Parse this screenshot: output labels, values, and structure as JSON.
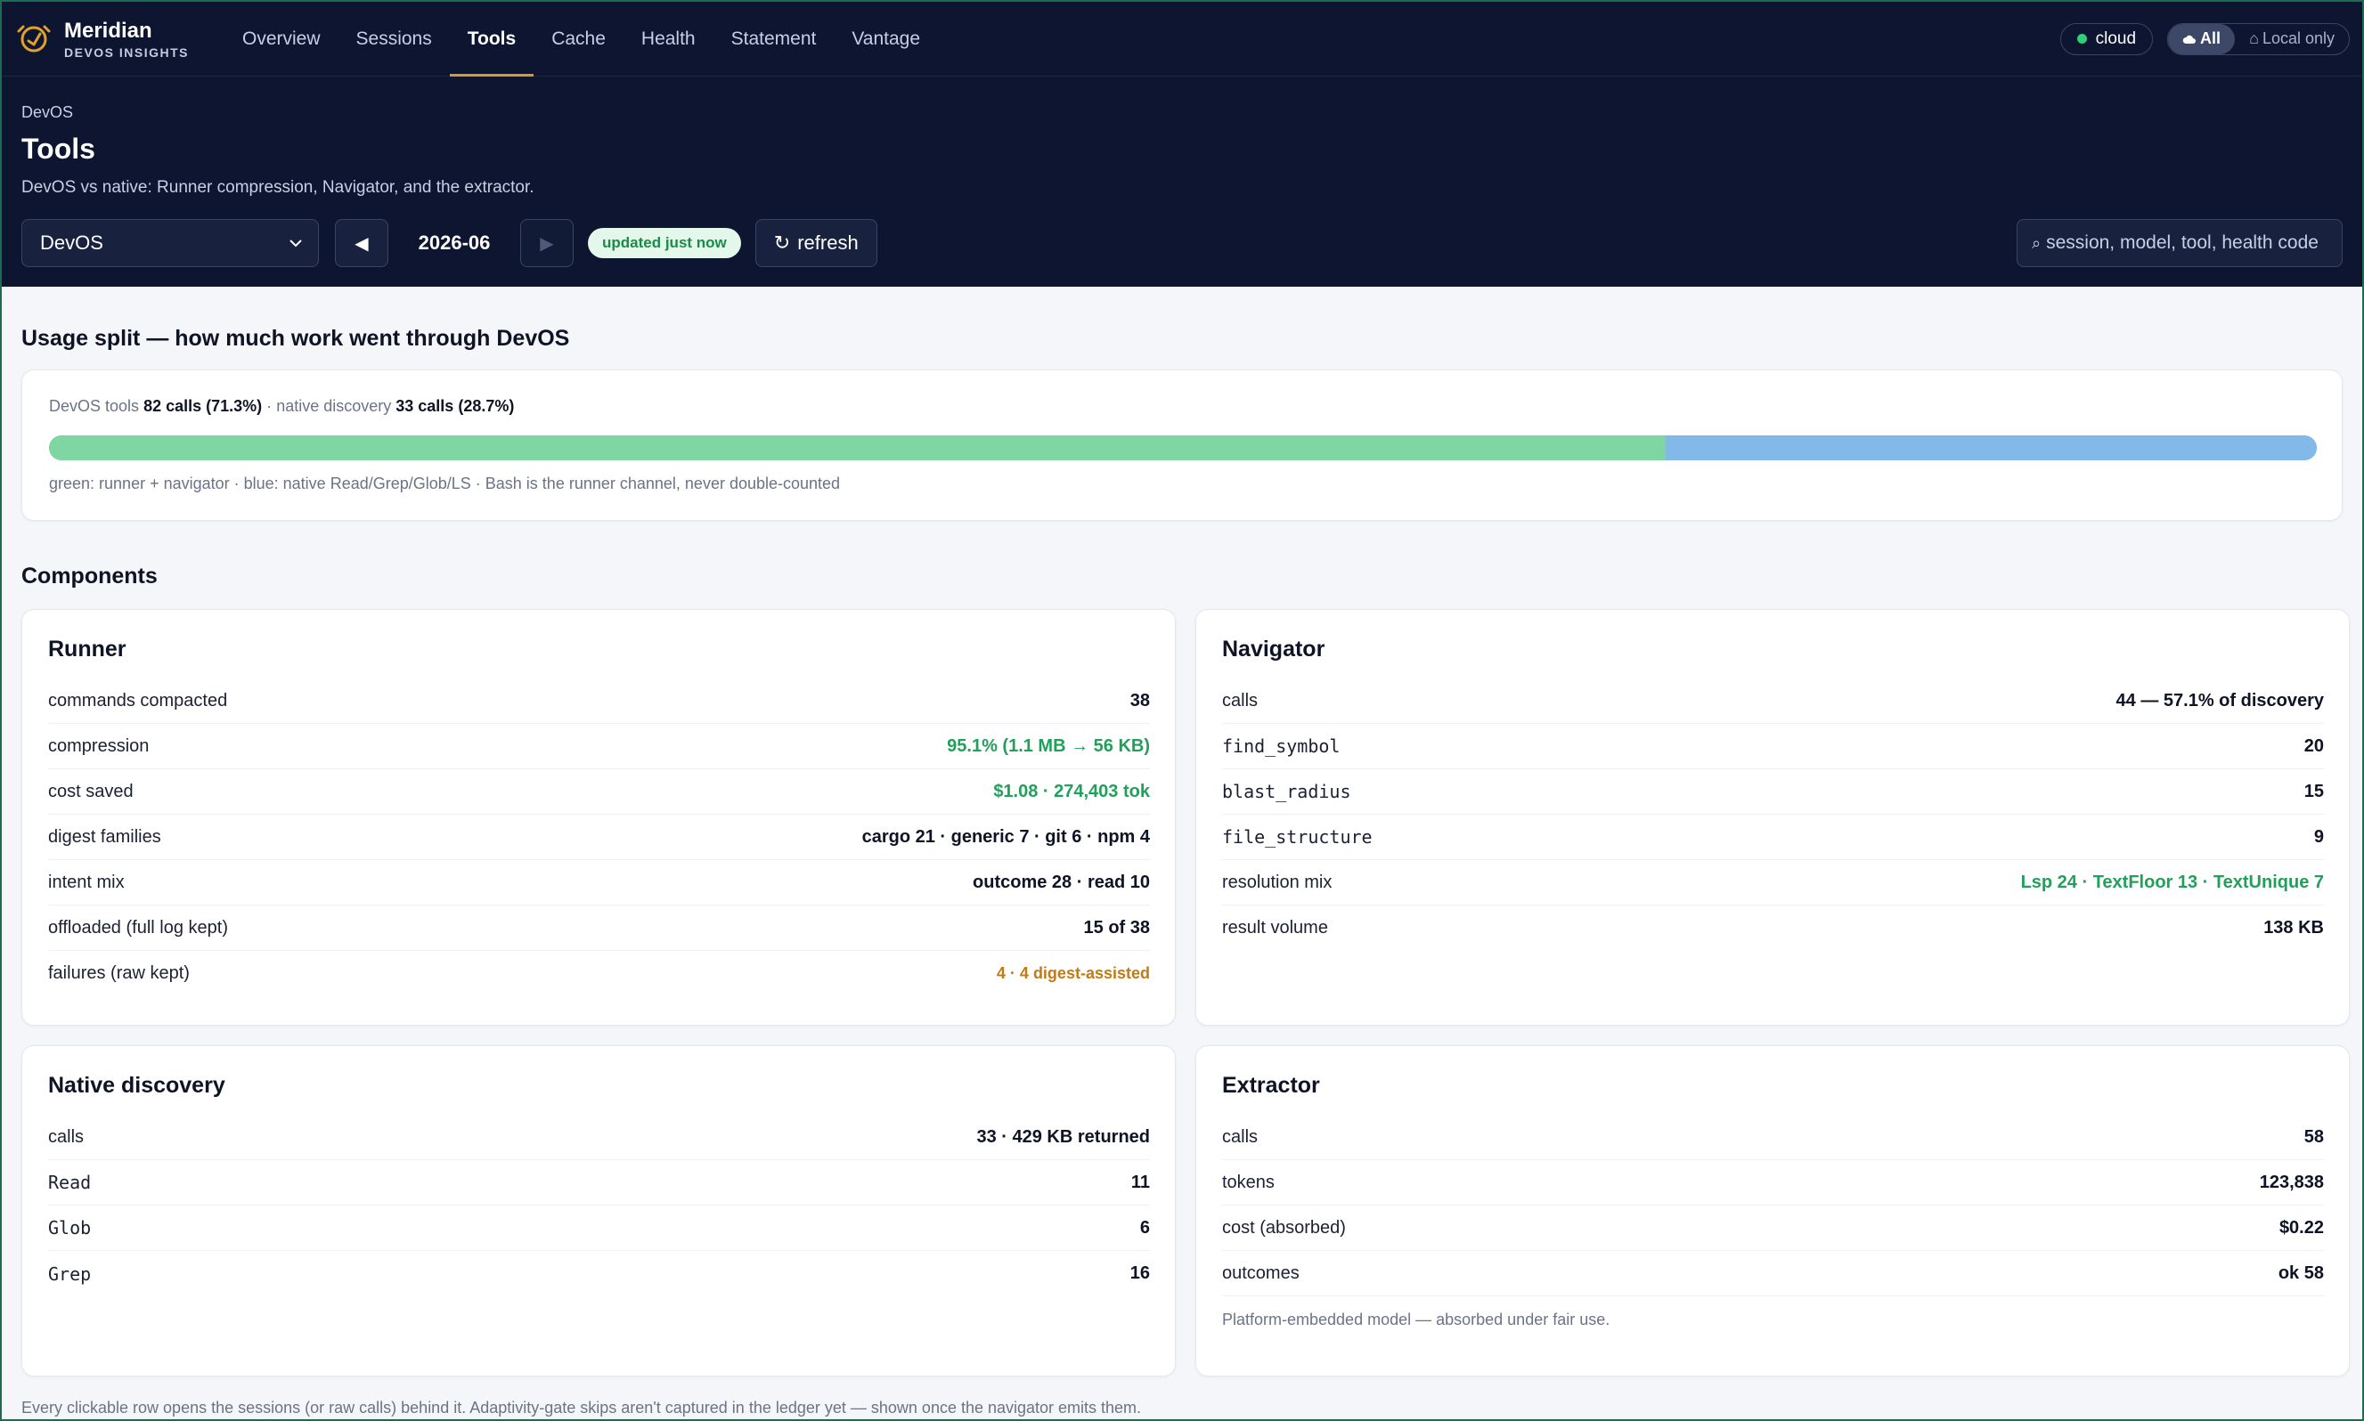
{
  "brand": {
    "name": "Meridian",
    "sub": "DEVOS INSIGHTS"
  },
  "nav": [
    "Overview",
    "Sessions",
    "Tools",
    "Cache",
    "Health",
    "Statement",
    "Vantage"
  ],
  "status": {
    "cloud": "cloud",
    "all": "All",
    "local_only": "Local only"
  },
  "header": {
    "crumb": "DevOS",
    "title": "Tools",
    "subtitle": "DevOS vs native: Runner compression, Navigator, and the extractor.",
    "select_value": "DevOS",
    "month": "2026-06",
    "updated": "updated just now",
    "refresh": "refresh",
    "search_placeholder": "session, model, tool, health code"
  },
  "usage": {
    "title": "Usage split — how much work went through DevOS",
    "devos_label": "DevOS tools",
    "devos_value": "82 calls (71.3%)",
    "sep": "·",
    "native_label": "native discovery",
    "native_value": "33 calls (28.7%)",
    "devos_fraction": 0.713,
    "note": "green: runner + navigator · blue: native Read/Grep/Glob/LS · Bash is the runner channel, never double-counted",
    "colors": {
      "devos": "#7fd6a2",
      "native": "#82b9e8"
    }
  },
  "components_title": "Components",
  "panels": {
    "runner": {
      "title": "Runner",
      "rows": [
        {
          "k": "commands compacted",
          "v": "38"
        },
        {
          "k": "compression",
          "v": "95.1% (1.1 MB → 56 KB)"
        },
        {
          "k": "cost saved",
          "v": "$1.08 · 274,403 tok"
        },
        {
          "k": "digest families",
          "v": "cargo 21 · generic 7 · git 6 · npm 4"
        },
        {
          "k": "intent mix",
          "v": "outcome 28 · read 10"
        },
        {
          "k": "offloaded (full log kept)",
          "v": "15 of 38"
        },
        {
          "k": "failures (raw kept)",
          "v": "4 · 4 digest-assisted"
        }
      ]
    },
    "navigator": {
      "title": "Navigator",
      "rows": [
        {
          "k": "calls",
          "v": "44 — 57.1% of discovery"
        },
        {
          "k": "find_symbol",
          "v": "20"
        },
        {
          "k": "blast_radius",
          "v": "15"
        },
        {
          "k": "file_structure",
          "v": "9"
        },
        {
          "k": "resolution mix",
          "v": "Lsp 24 · TextFloor 13 · TextUnique 7"
        },
        {
          "k": "result volume",
          "v": "138 KB"
        }
      ]
    },
    "native": {
      "title": "Native discovery",
      "rows": [
        {
          "k": "calls",
          "v": "33 · 429 KB returned"
        },
        {
          "k": "Read",
          "v": "11"
        },
        {
          "k": "Glob",
          "v": "6"
        },
        {
          "k": "Grep",
          "v": "16"
        }
      ]
    },
    "extractor": {
      "title": "Extractor",
      "rows": [
        {
          "k": "calls",
          "v": "58"
        },
        {
          "k": "tokens",
          "v": "123,838"
        },
        {
          "k": "cost (absorbed)",
          "v": "$0.22"
        },
        {
          "k": "outcomes",
          "v": "ok 58"
        }
      ],
      "note": "Platform-embedded model — absorbed under fair use."
    }
  },
  "footer": "Every clickable row opens the sessions (or raw calls) behind it. Adaptivity-gate skips aren't captured in the ledger yet — shown once the navigator emits them.",
  "icons": {
    "search": "search-icon",
    "refresh": "refresh-icon",
    "prev": "triangle-left-icon",
    "next": "triangle-right-icon",
    "chevron": "chevron-down-icon",
    "cloud": "cloud-icon",
    "home": "home-icon"
  }
}
